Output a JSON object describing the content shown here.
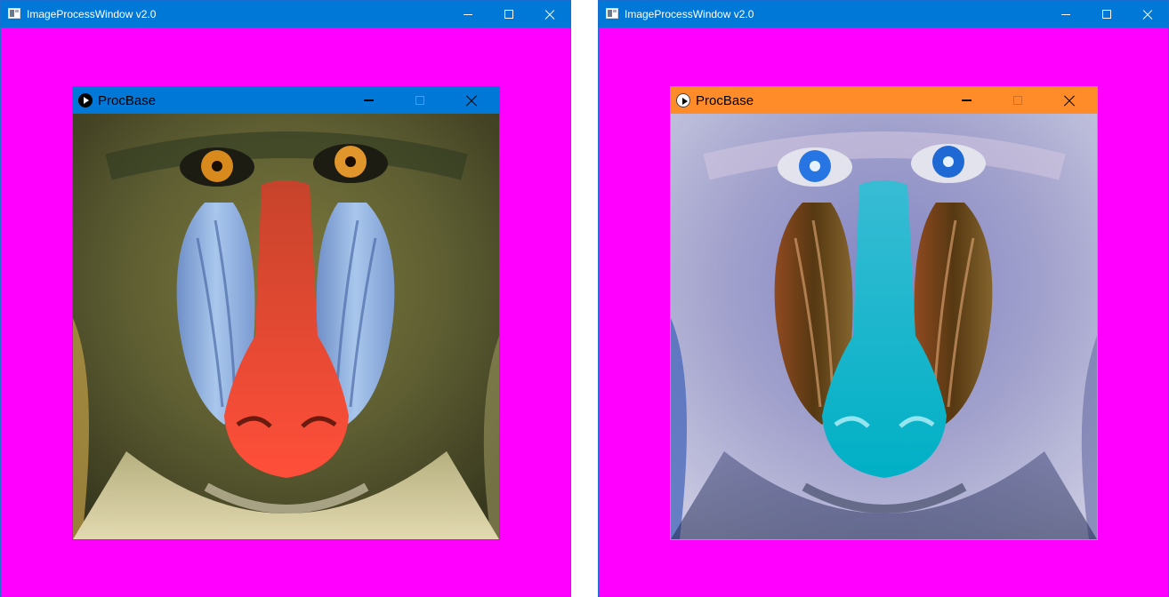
{
  "windows": [
    {
      "title": "ImageProcessWindow v2.0",
      "controls": {
        "minimize": "minimize",
        "maximize": "maximize",
        "close": "close"
      },
      "child": {
        "title": "ProcBase",
        "image": "mandrill-photo-original-colors"
      }
    },
    {
      "title": "ImageProcessWindow v2.0",
      "controls": {
        "minimize": "minimize",
        "maximize": "maximize",
        "close": "close"
      },
      "child": {
        "title": "ProcBase",
        "image": "mandrill-photo-inverted-colors"
      }
    }
  ],
  "colors": {
    "app_titlebar": "#0078d7",
    "client_background": "#ff00ff",
    "child_titlebar_left": "#0078d7",
    "child_titlebar_right": "#ff8c28"
  }
}
